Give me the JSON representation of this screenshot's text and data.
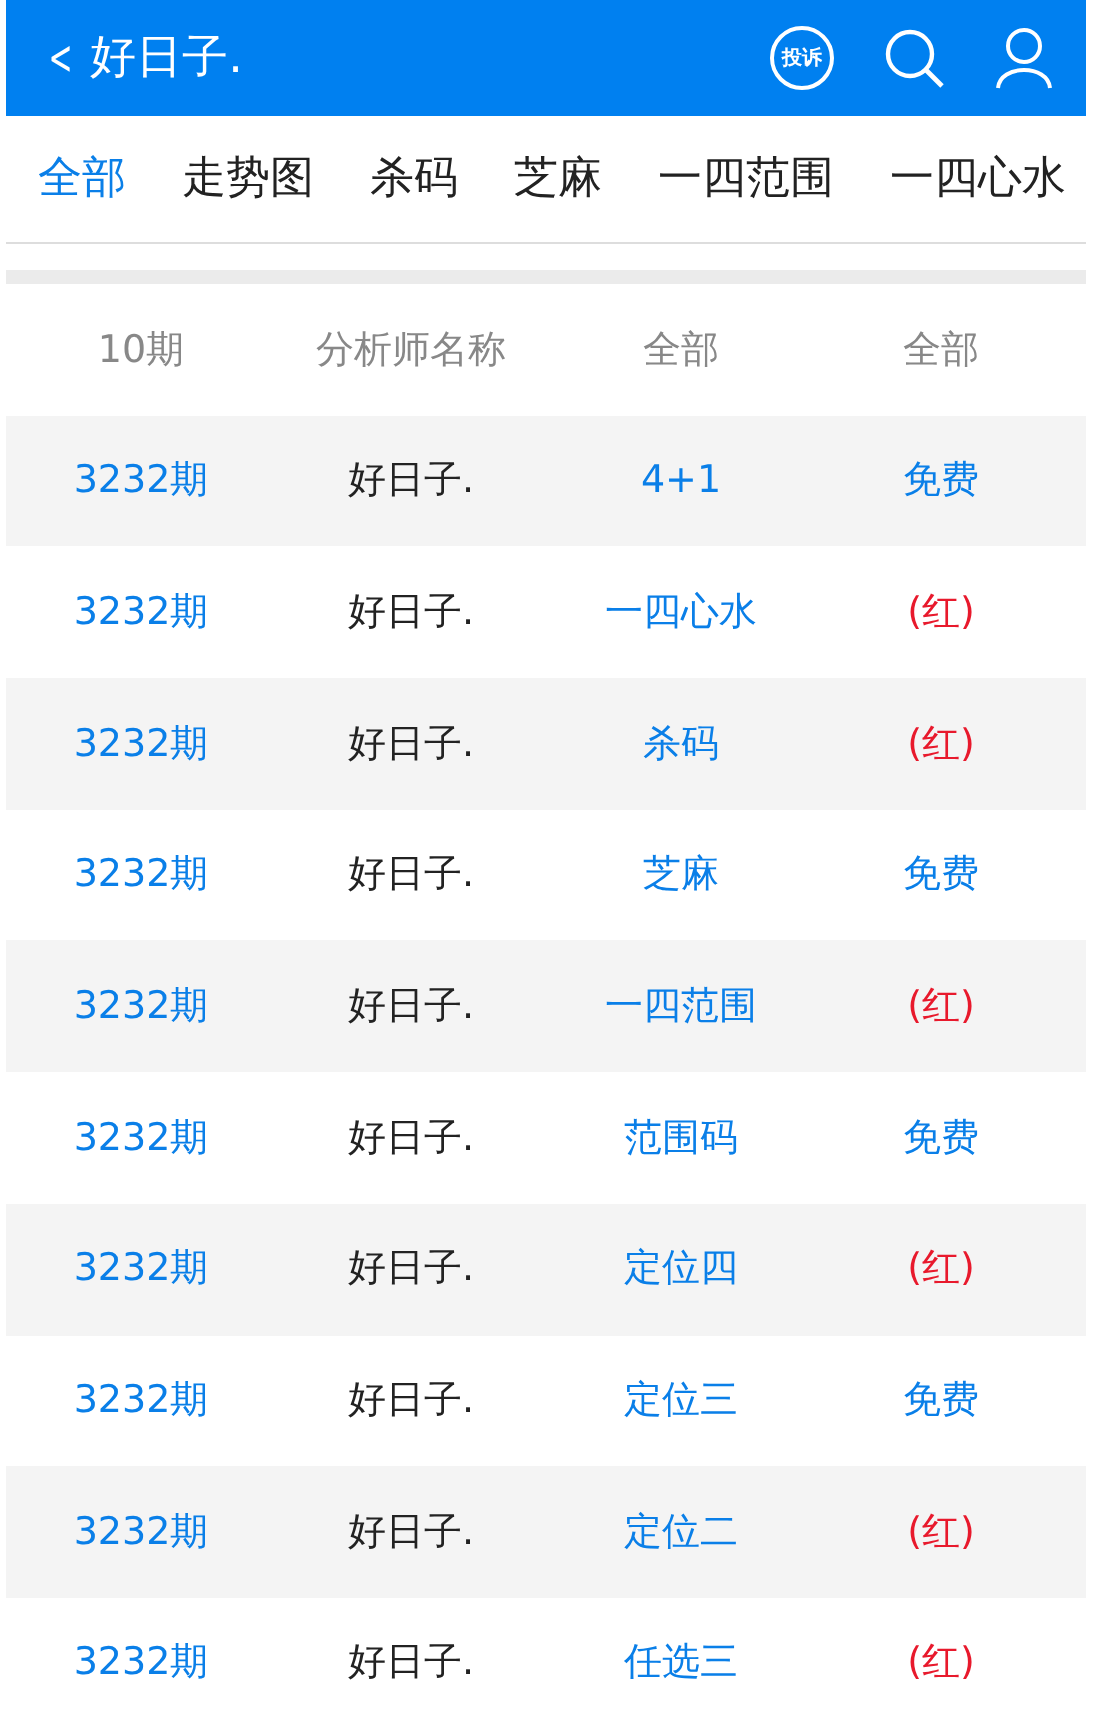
{
  "header": {
    "back": "<",
    "title": "好日子.",
    "complaint": "投诉"
  },
  "tabs": [
    {
      "label": "全部",
      "selected": true
    },
    {
      "label": "走势图",
      "selected": false
    },
    {
      "label": "杀码",
      "selected": false
    },
    {
      "label": "芝麻",
      "selected": false
    },
    {
      "label": "一四范围",
      "selected": false
    },
    {
      "label": "一四心水",
      "selected": false
    }
  ],
  "table": {
    "columns": [
      "10期",
      "分析师名称",
      "全部",
      "全部"
    ],
    "rows": [
      {
        "issue": "3232期",
        "analyst": "好日子.",
        "type": "4+1",
        "result": "免费",
        "kind": "free"
      },
      {
        "issue": "3232期",
        "analyst": "好日子.",
        "type": "一四心水",
        "result": "(红)",
        "kind": "hit"
      },
      {
        "issue": "3232期",
        "analyst": "好日子.",
        "type": "杀码",
        "result": "(红)",
        "kind": "hit"
      },
      {
        "issue": "3232期",
        "analyst": "好日子.",
        "type": "芝麻",
        "result": "免费",
        "kind": "free"
      },
      {
        "issue": "3232期",
        "analyst": "好日子.",
        "type": "一四范围",
        "result": "(红)",
        "kind": "hit"
      },
      {
        "issue": "3232期",
        "analyst": "好日子.",
        "type": "范围码",
        "result": "免费",
        "kind": "free"
      },
      {
        "issue": "3232期",
        "analyst": "好日子.",
        "type": "定位四",
        "result": "(红)",
        "kind": "hit"
      },
      {
        "issue": "3232期",
        "analyst": "好日子.",
        "type": "定位三",
        "result": "免费",
        "kind": "free"
      },
      {
        "issue": "3232期",
        "analyst": "好日子.",
        "type": "定位二",
        "result": "(红)",
        "kind": "hit"
      },
      {
        "issue": "3232期",
        "analyst": "好日子.",
        "type": "任选三",
        "result": "(红)",
        "kind": "hit"
      }
    ]
  }
}
